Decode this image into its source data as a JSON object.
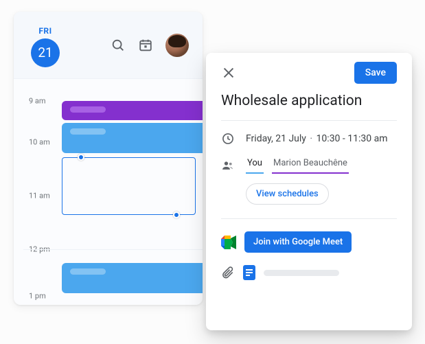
{
  "calendar": {
    "day_name": "FRI",
    "day_number": "21",
    "time_labels": [
      "9 am",
      "10 am",
      "11 am",
      "12 pm",
      "1 pm"
    ]
  },
  "detail": {
    "save_label": "Save",
    "title": "Wholesale application",
    "date_text": "Friday, 21 July",
    "time_text": "10:30 - 11:30 am",
    "guests": {
      "you_label": "You",
      "other_label": "Marion Beauchêne"
    },
    "view_schedules_label": "View schedules",
    "join_meet_label": "Join with Google Meet"
  }
}
